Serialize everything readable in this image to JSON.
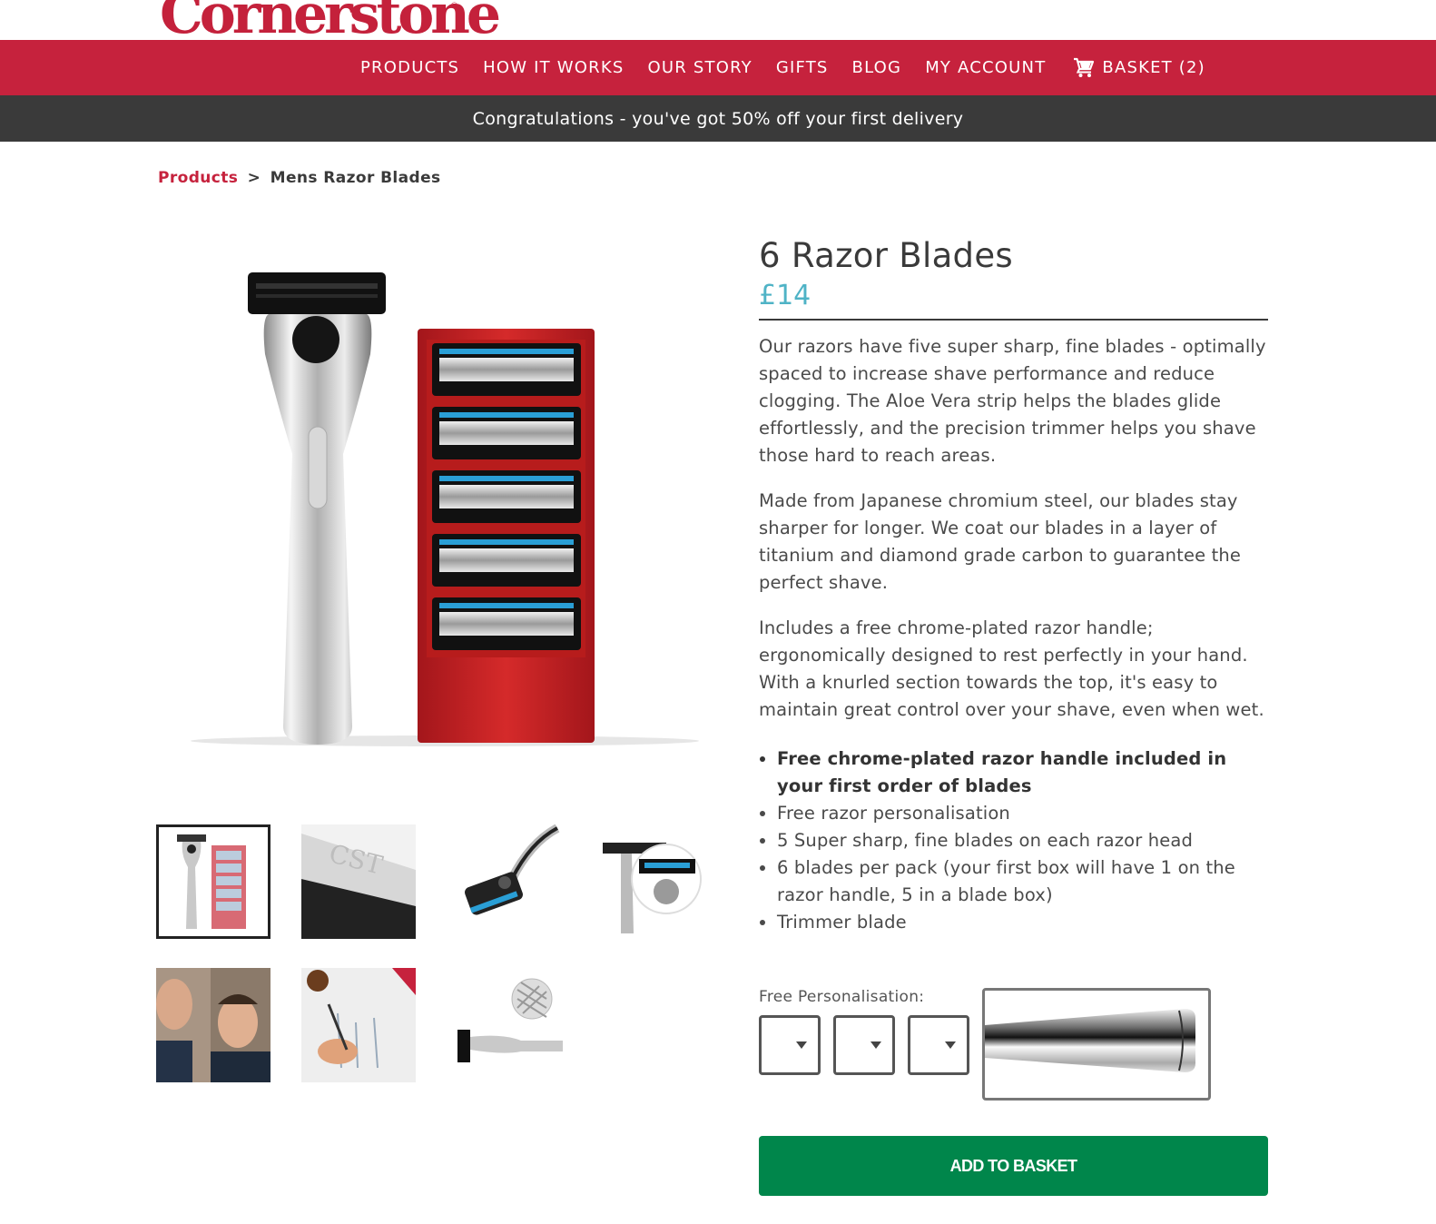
{
  "brand": {
    "logo": "Cornerstone",
    "registered_mark": "®",
    "color": "#c6223d"
  },
  "nav": {
    "items": [
      "PRODUCTS",
      "HOW IT WORKS",
      "OUR STORY",
      "GIFTS",
      "BLOG",
      "MY ACCOUNT"
    ],
    "basket_icon": "cart-icon",
    "basket_label": "BASKET (2)"
  },
  "promo": {
    "text": "Congratulations - you've got 50% off your first delivery"
  },
  "breadcrumb": {
    "link": "Products",
    "separator": ">",
    "current": "Mens Razor Blades"
  },
  "gallery": {
    "main_image": "razor-and-blade-box",
    "thumbnails": [
      "razor-and-box",
      "engraved-handle-cst",
      "razor-head-angle",
      "blade-closeup",
      "man-shaving",
      "design-sketches",
      "razor-knurling"
    ],
    "selected_index": 0
  },
  "product": {
    "title": "6 Razor Blades",
    "price": "£14",
    "price_color": "#4fb3c6",
    "description": [
      "Our razors have five super sharp, fine blades - optimally spaced to increase shave performance and reduce clogging. The Aloe Vera strip helps the blades glide effortlessly, and the precision trimmer helps you shave those hard to reach areas.",
      "Made from Japanese chromium steel, our blades stay sharper for longer. We coat our blades in a layer of titanium and diamond grade carbon to guarantee the perfect shave.",
      "Includes a free chrome-plated razor handle; ergonomically designed to rest perfectly in your hand. With a knurled section towards the top, it's easy to maintain great control over your shave, even when wet."
    ],
    "features": [
      "Free chrome-plated razor handle included in your first order of blades",
      "Free razor personalisation",
      "5 Super sharp, fine blades on each razor head",
      "6 blades per pack (your first box will have 1 on the razor handle, 5 in a blade box)",
      "Trimmer blade"
    ]
  },
  "personalisation": {
    "label": "Free Personalisation:",
    "initials": [
      "",
      "",
      ""
    ],
    "preview": "handle-preview"
  },
  "cta": {
    "label": "ADD TO BASKET",
    "color": "#00864b"
  }
}
